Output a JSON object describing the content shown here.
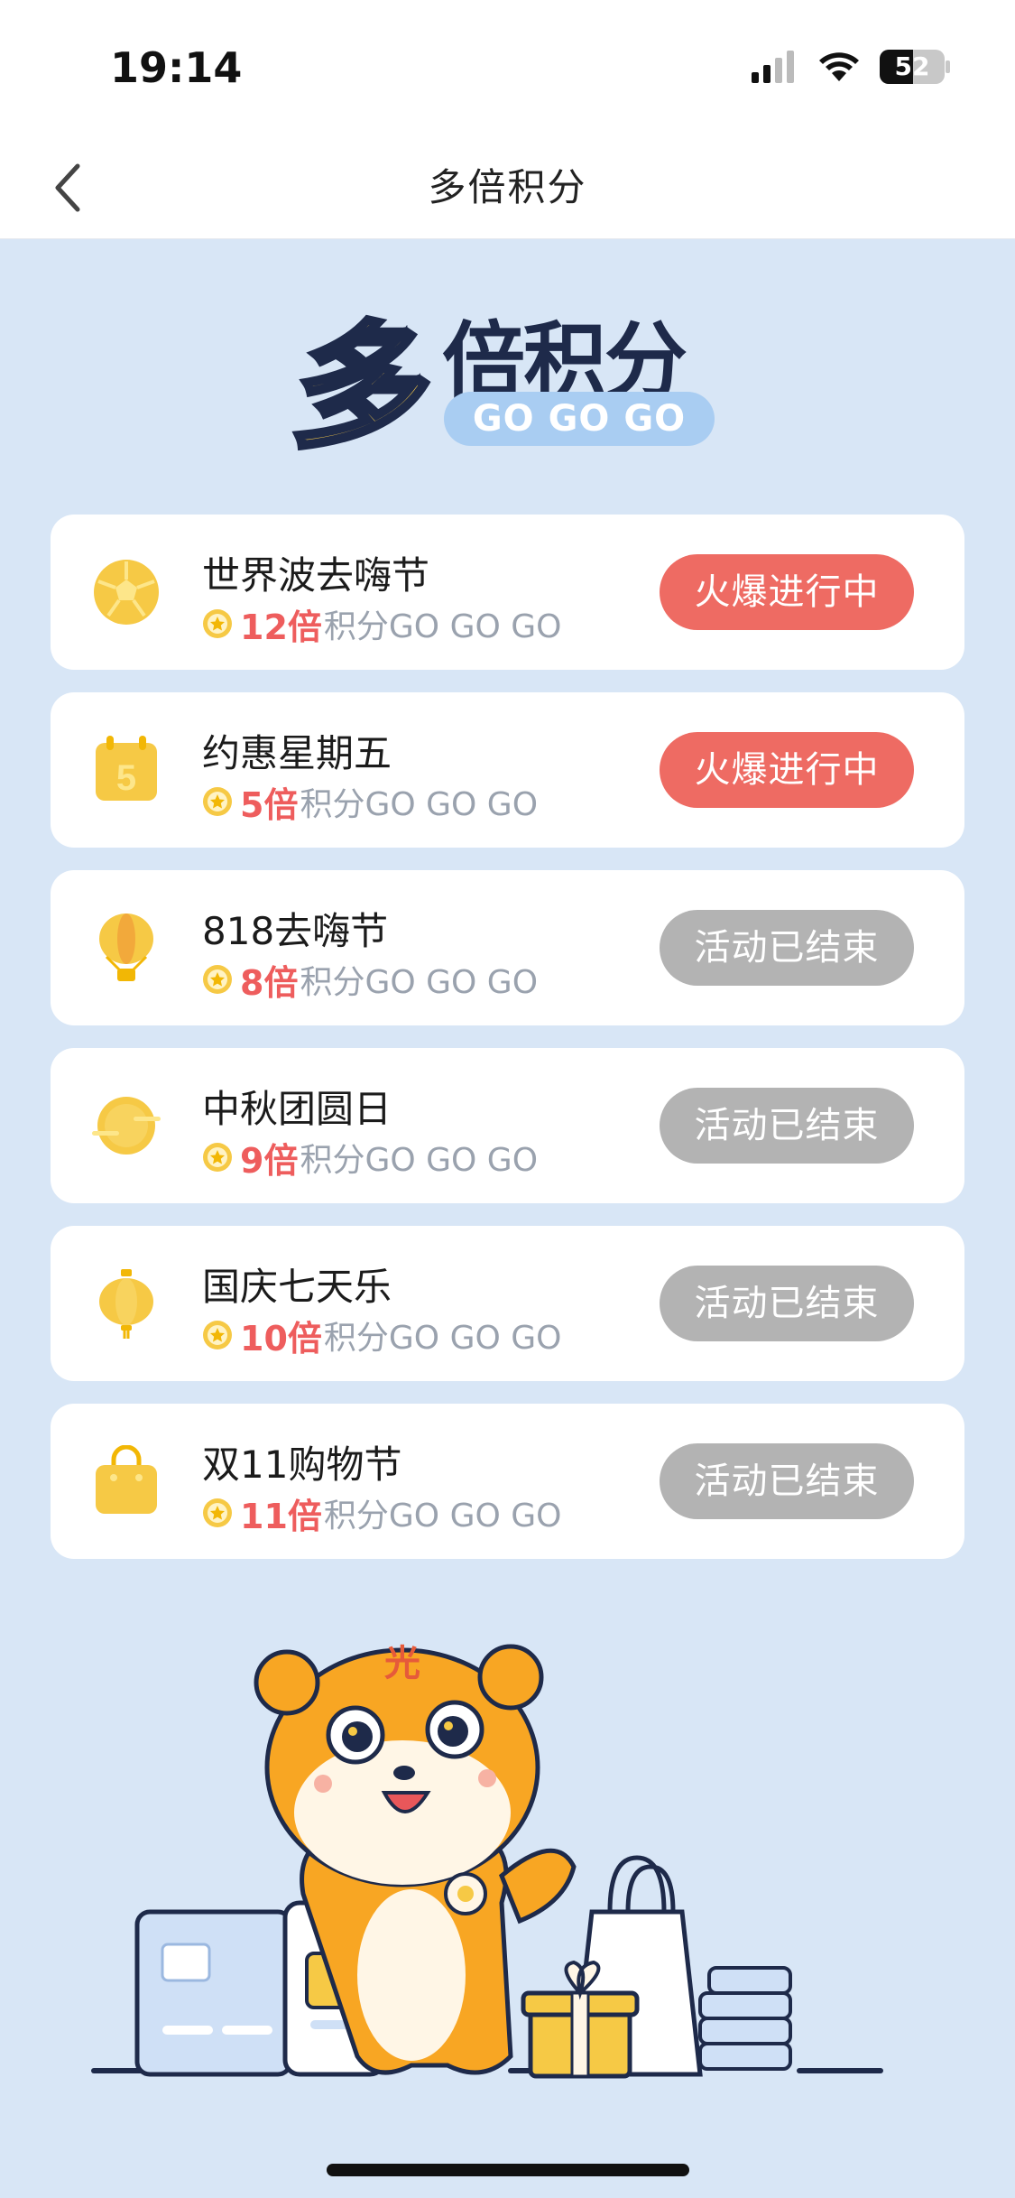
{
  "status": {
    "time": "19:14",
    "battery": "52"
  },
  "nav": {
    "title": "多倍积分"
  },
  "hero": {
    "first_char": "多",
    "rest_chars": "倍积分",
    "pill_text": "GO GO GO"
  },
  "activities": [
    {
      "name": "世界波去嗨节",
      "multiplier": "12倍",
      "suffix": "积分GO GO GO",
      "button": "火爆进行中",
      "state": "active",
      "icon": "soccer-ball-icon"
    },
    {
      "name": "约惠星期五",
      "multiplier": "5倍",
      "suffix": "积分GO GO GO",
      "button": "火爆进行中",
      "state": "active",
      "icon": "calendar-5-icon"
    },
    {
      "name": "818去嗨节",
      "multiplier": "8倍",
      "suffix": "积分GO GO GO",
      "button": "活动已结束",
      "state": "ended",
      "icon": "hot-air-balloon-icon"
    },
    {
      "name": "中秋团圆日",
      "multiplier": "9倍",
      "suffix": "积分GO GO GO",
      "button": "活动已结束",
      "state": "ended",
      "icon": "moon-icon"
    },
    {
      "name": "国庆七天乐",
      "multiplier": "10倍",
      "suffix": "积分GO GO GO",
      "button": "活动已结束",
      "state": "ended",
      "icon": "lantern-icon"
    },
    {
      "name": "双11购物节",
      "multiplier": "11倍",
      "suffix": "积分GO GO GO",
      "button": "活动已结束",
      "state": "ended",
      "icon": "shopping-bag-icon"
    }
  ],
  "mascot": {
    "forehead_char": "光"
  },
  "colors": {
    "background": "#d8e6f6",
    "active_button": "#ee6b63",
    "ended_button": "#b3b3b3",
    "multiplier_red": "#ee5d5d",
    "icon_yellow": "#f6c945"
  }
}
